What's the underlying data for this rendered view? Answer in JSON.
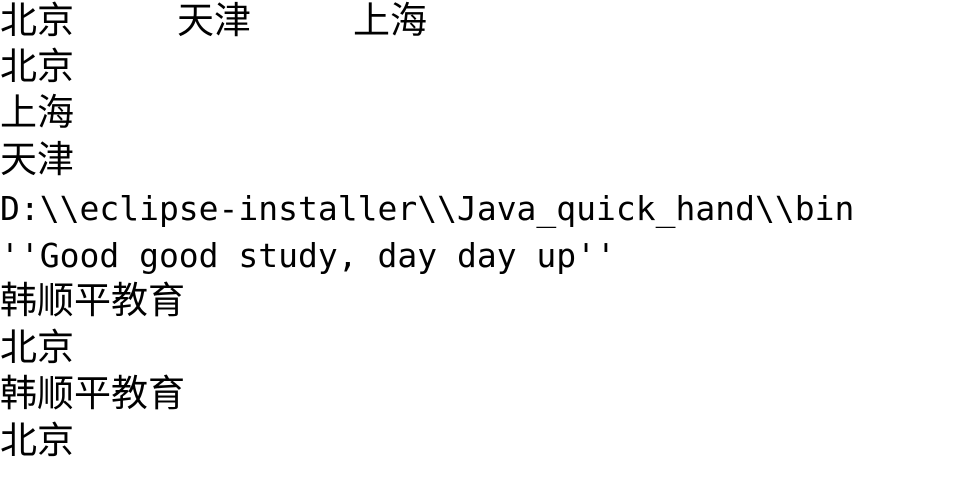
{
  "console": {
    "row1": [
      "北京",
      "天津",
      "上海"
    ],
    "lines": [
      "北京",
      "上海",
      "天津",
      "D:\\\\eclipse-installer\\\\Java_quick_hand\\\\bin",
      "''Good good study, day day up''",
      "韩顺平教育",
      "北京",
      "韩顺平教育",
      "北京"
    ]
  }
}
